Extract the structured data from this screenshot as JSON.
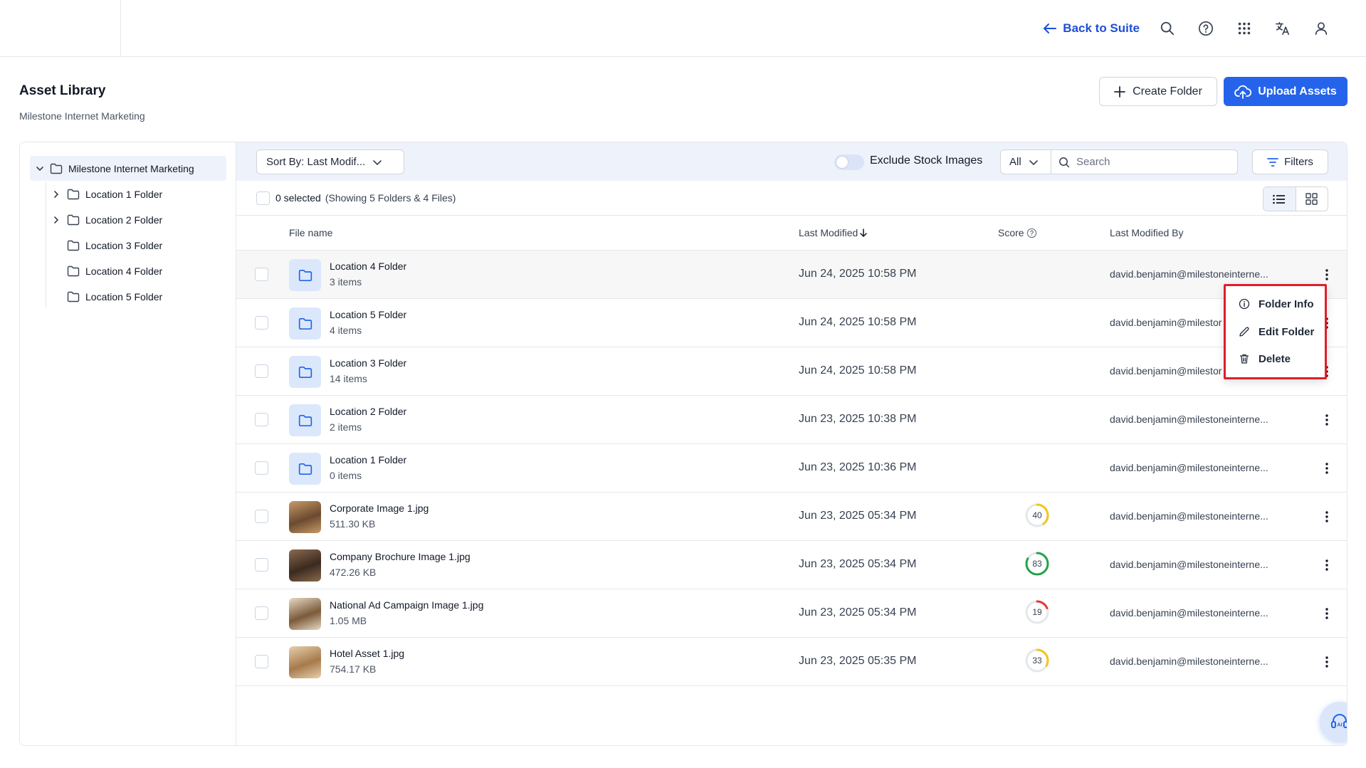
{
  "topbar": {
    "back_label": "Back to Suite"
  },
  "header": {
    "title": "Asset Library",
    "subtitle": "Milestone Internet Marketing",
    "create_folder_label": "Create Folder",
    "upload_label": "Upload Assets"
  },
  "sidebar": {
    "root_label": "Milestone Internet Marketing",
    "items": [
      {
        "label": "Location 1 Folder",
        "expandable": true
      },
      {
        "label": "Location 2 Folder",
        "expandable": true
      },
      {
        "label": "Location 3 Folder",
        "expandable": false
      },
      {
        "label": "Location 4 Folder",
        "expandable": false
      },
      {
        "label": "Location 5 Folder",
        "expandable": false
      }
    ]
  },
  "toolbar": {
    "sort_label": "Sort By: Last Modif...",
    "exclude_stock_label": "Exclude Stock Images",
    "exclude_stock_on": false,
    "type_filter_value": "All",
    "search_placeholder": "Search",
    "filters_label": "Filters"
  },
  "selection": {
    "count_label": "0 selected",
    "showing_label": "(Showing 5 Folders & 4 Files)"
  },
  "table": {
    "headers": {
      "file_name": "File name",
      "last_modified": "Last Modified",
      "score": "Score",
      "last_modified_by": "Last Modified By"
    },
    "rows": [
      {
        "name": "Location 4 Folder",
        "sub": "3 items",
        "date": "Jun 24, 2025 10:58 PM",
        "by": "david.benjamin@milestoneinterne...",
        "kind": "folder"
      },
      {
        "name": "Location 5 Folder",
        "sub": "4 items",
        "date": "Jun 24, 2025 10:58 PM",
        "by": "david.benjamin@milestor",
        "kind": "folder"
      },
      {
        "name": "Location 3 Folder",
        "sub": "14 items",
        "date": "Jun 24, 2025 10:58 PM",
        "by": "david.benjamin@milestor",
        "kind": "folder"
      },
      {
        "name": "Location 2 Folder",
        "sub": "2 items",
        "date": "Jun 23, 2025 10:38 PM",
        "by": "david.benjamin@milestoneinterne...",
        "kind": "folder"
      },
      {
        "name": "Location 1 Folder",
        "sub": "0 items",
        "date": "Jun 23, 2025 10:36 PM",
        "by": "david.benjamin@milestoneinterne...",
        "kind": "folder"
      },
      {
        "name": "Corporate Image 1.jpg",
        "sub": "511.30 KB",
        "date": "Jun 23, 2025 05:34 PM",
        "by": "david.benjamin@milestoneinterne...",
        "kind": "image",
        "score": "40",
        "score_pct": 0.4,
        "score_color": "#f5c518",
        "thumb_colors": [
          "#6b4a2e",
          "#c89a6a"
        ]
      },
      {
        "name": "Company Brochure Image 1.jpg",
        "sub": "472.26 KB",
        "date": "Jun 23, 2025 05:34 PM",
        "by": "david.benjamin@milestoneinterne...",
        "kind": "image",
        "score": "83",
        "score_pct": 0.83,
        "score_color": "#22a447",
        "thumb_colors": [
          "#3b2a1f",
          "#8a6a4f"
        ]
      },
      {
        "name": "National Ad Campaign Image 1.jpg",
        "sub": "1.05 MB",
        "date": "Jun 23, 2025 05:34 PM",
        "by": "david.benjamin@milestoneinterne...",
        "kind": "image",
        "score": "19",
        "score_pct": 0.19,
        "score_color": "#e53935",
        "thumb_colors": [
          "#7a5a3a",
          "#e8d9c4"
        ]
      },
      {
        "name": "Hotel Asset 1.jpg",
        "sub": "754.17 KB",
        "date": "Jun 23, 2025 05:35 PM",
        "by": "david.benjamin@milestoneinterne...",
        "kind": "image",
        "score": "33",
        "score_pct": 0.33,
        "score_color": "#f5c518",
        "thumb_colors": [
          "#a77a4a",
          "#e6cfae"
        ]
      }
    ]
  },
  "context_menu": {
    "items": [
      {
        "label": "Folder Info",
        "icon": "info-icon"
      },
      {
        "label": "Edit Folder",
        "icon": "pencil-icon"
      },
      {
        "label": "Delete",
        "icon": "trash-icon"
      }
    ]
  },
  "colors": {
    "accent": "#2563eb",
    "highlight_border": "#e11d2a",
    "toolbar_bg": "#eef2fb"
  }
}
